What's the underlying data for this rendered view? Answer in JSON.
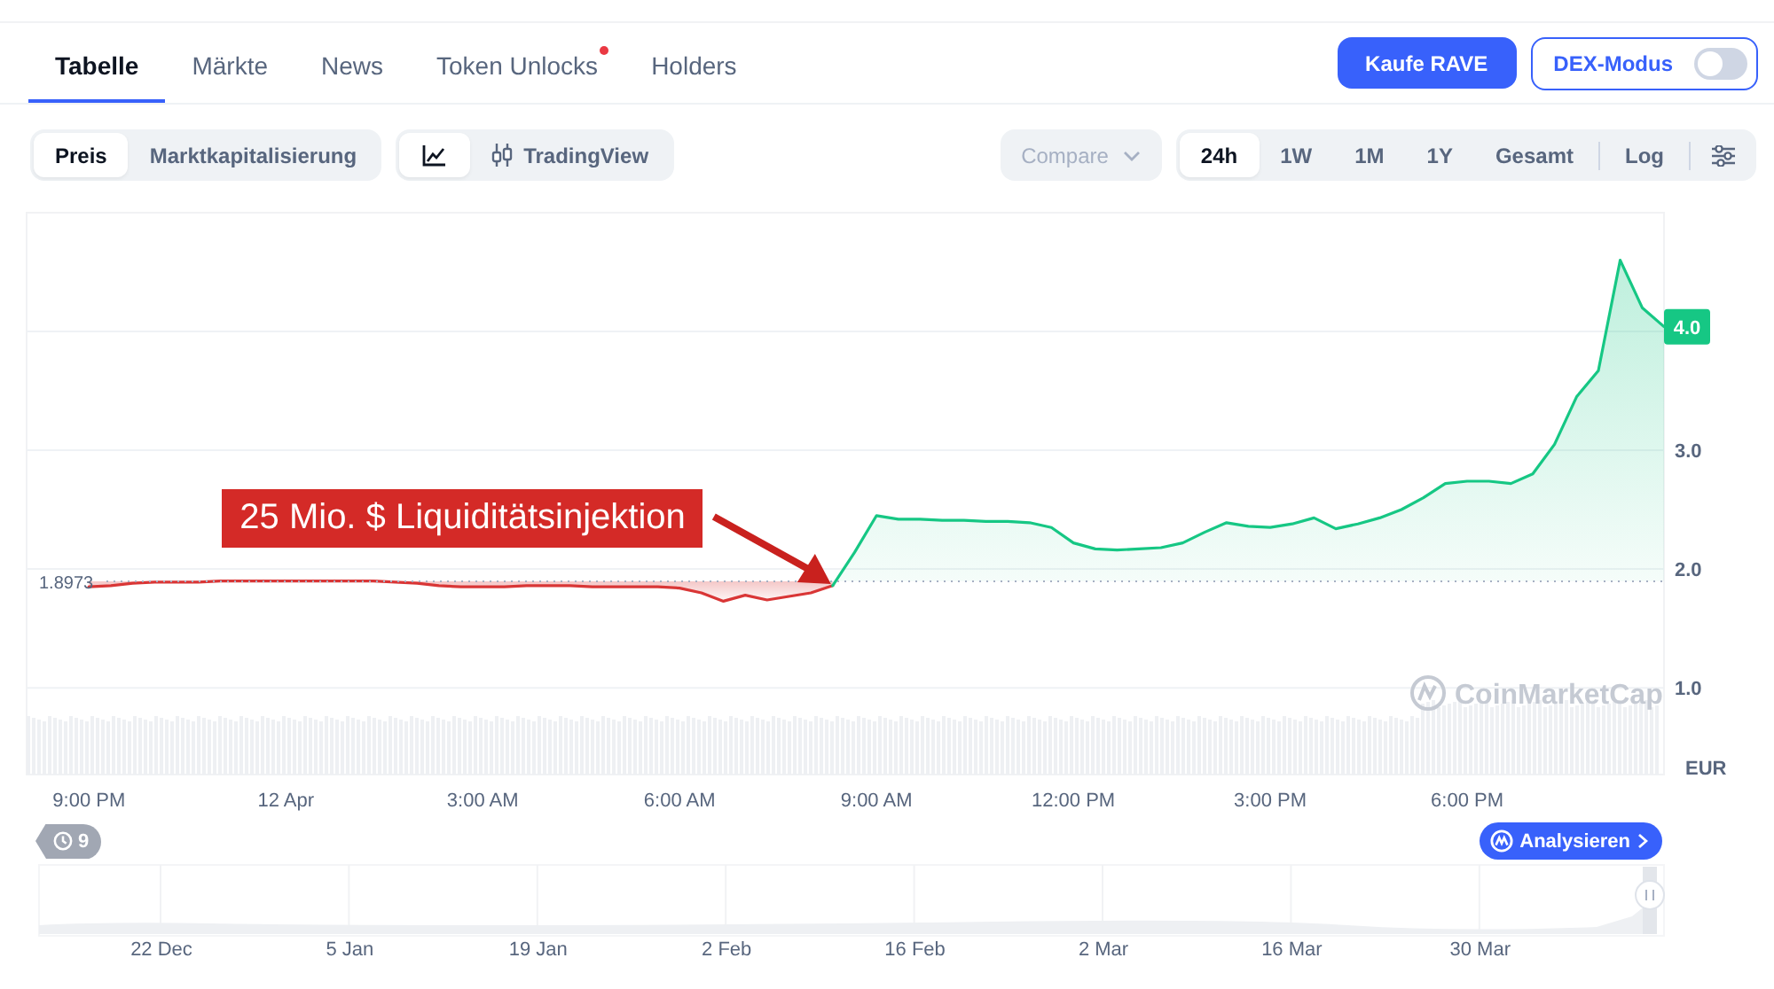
{
  "tabs": [
    {
      "label": "Tabelle",
      "selected": true,
      "notification": false
    },
    {
      "label": "Märkte",
      "selected": false,
      "notification": false
    },
    {
      "label": "News",
      "selected": false,
      "notification": false
    },
    {
      "label": "Token Unlocks",
      "selected": false,
      "notification": true
    },
    {
      "label": "Holders",
      "selected": false,
      "notification": false
    }
  ],
  "buy_button": "Kaufe RAVE",
  "dex_mode": {
    "label": "DEX-Modus",
    "on": false
  },
  "chart_type_tabs": [
    {
      "label": "Preis",
      "selected": true
    },
    {
      "label": "Marktkapitalisierung",
      "selected": false
    }
  ],
  "view_tabs": [
    {
      "kind": "line_chart",
      "selected": true
    },
    {
      "kind": "tradingview",
      "label": "TradingView",
      "selected": false
    }
  ],
  "compare": {
    "label": "Compare",
    "disabled": true
  },
  "ranges": [
    {
      "label": "24h",
      "selected": true
    },
    {
      "label": "1W",
      "selected": false
    },
    {
      "label": "1M",
      "selected": false
    },
    {
      "label": "1Y",
      "selected": false
    },
    {
      "label": "Gesamt",
      "selected": false
    }
  ],
  "log": {
    "label": "Log",
    "selected": false
  },
  "price_chart": {
    "currency": "EUR",
    "watermark": "CoinMarketCap",
    "current_price": "4.0",
    "chart_data": {
      "type": "area",
      "grid": true,
      "categories": [
        "9:00 PM",
        null,
        null,
        null,
        null,
        null,
        null,
        null,
        null,
        "12 Apr",
        null,
        null,
        null,
        null,
        null,
        null,
        null,
        null,
        "3:00 AM",
        null,
        null,
        null,
        null,
        null,
        null,
        null,
        null,
        "6:00 AM",
        null,
        null,
        null,
        null,
        null,
        null,
        null,
        null,
        "9:00 AM",
        null,
        null,
        null,
        null,
        null,
        null,
        null,
        null,
        "12:00 PM",
        null,
        null,
        null,
        null,
        null,
        null,
        null,
        null,
        "3:00 PM",
        null,
        null,
        null,
        null,
        null,
        null,
        null,
        null,
        "6:00 PM",
        null,
        null,
        null,
        null,
        null,
        null,
        null,
        null,
        null
      ],
      "series": [
        {
          "color": "#d93636",
          "values": [
            1.85,
            1.86,
            1.88,
            1.89,
            1.89,
            1.89,
            1.9,
            1.9,
            1.9,
            1.9,
            1.9,
            1.9,
            1.9,
            1.9,
            1.89,
            1.88,
            1.86,
            1.85,
            1.85,
            1.85,
            1.86,
            1.86,
            1.86,
            1.85,
            1.85,
            1.85,
            1.85,
            1.84,
            1.8,
            1.73,
            1.78,
            1.74,
            1.77,
            1.8,
            1.86,
            null,
            null,
            null,
            null,
            null,
            null,
            null,
            null,
            null,
            null,
            null,
            null,
            null,
            null,
            null,
            null,
            null,
            null,
            null,
            null,
            null,
            null,
            null,
            null,
            null,
            null,
            null,
            null,
            null,
            null,
            null,
            null,
            null,
            null,
            null,
            null,
            null,
            null
          ]
        },
        {
          "color": "#16c784",
          "values": [
            null,
            null,
            null,
            null,
            null,
            null,
            null,
            null,
            null,
            null,
            null,
            null,
            null,
            null,
            null,
            null,
            null,
            null,
            null,
            null,
            null,
            null,
            null,
            null,
            null,
            null,
            null,
            null,
            null,
            null,
            null,
            null,
            null,
            null,
            1.86,
            2.14,
            2.45,
            2.42,
            2.42,
            2.41,
            2.41,
            2.4,
            2.4,
            2.39,
            2.35,
            2.22,
            2.17,
            2.16,
            2.17,
            2.18,
            2.22,
            2.31,
            2.39,
            2.36,
            2.35,
            2.38,
            2.43,
            2.34,
            2.38,
            2.43,
            2.5,
            2.6,
            2.72,
            2.74,
            2.74,
            2.72,
            2.8,
            3.05,
            3.45,
            3.67,
            4.6,
            4.2,
            4.04
          ]
        }
      ],
      "ylim": [
        0.27,
        5.0
      ],
      "yticks": [
        {
          "value": 1,
          "label": "1.0"
        },
        {
          "value": 2,
          "label": "2.0"
        },
        {
          "value": 3,
          "label": "3.0"
        }
      ],
      "ref_lines": [
        {
          "axis": "y",
          "value": 1.8973,
          "label": "1.8973"
        }
      ],
      "annotations": [
        "25 Mio. $ Liquiditätsinjektion"
      ]
    }
  },
  "history_badge": {
    "count": "9"
  },
  "analyze_button": "Analysieren",
  "navigator": {
    "date_labels": [
      "22 Dec",
      "5 Jan",
      "19 Jan",
      "2 Feb",
      "16 Feb",
      "2 Mar",
      "16 Mar",
      "30 Mar"
    ]
  }
}
